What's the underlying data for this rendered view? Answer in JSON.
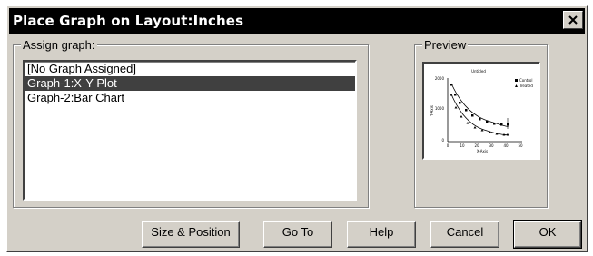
{
  "window": {
    "title": "Place Graph on Layout:Inches",
    "close_glyph": "✕"
  },
  "assign": {
    "legend": "Assign graph:",
    "items": [
      "[No Graph Assigned]",
      "Graph-1:X-Y Plot",
      "Graph-2:Bar Chart"
    ],
    "selected_index": 1
  },
  "preview": {
    "legend": "Preview",
    "mini_chart": {
      "title": "Untitled",
      "ylabel": "Y-Axis",
      "xlabel": "X-Axis",
      "yticks": [
        "2000",
        "1000",
        "0"
      ],
      "xticks": [
        "0",
        "10",
        "20",
        "30",
        "40",
        "50"
      ],
      "legend": [
        "Control",
        "Treated"
      ]
    }
  },
  "buttons": {
    "size_position": "Size & Position",
    "goto": "Go To",
    "help": "Help",
    "cancel": "Cancel",
    "ok": "OK"
  }
}
